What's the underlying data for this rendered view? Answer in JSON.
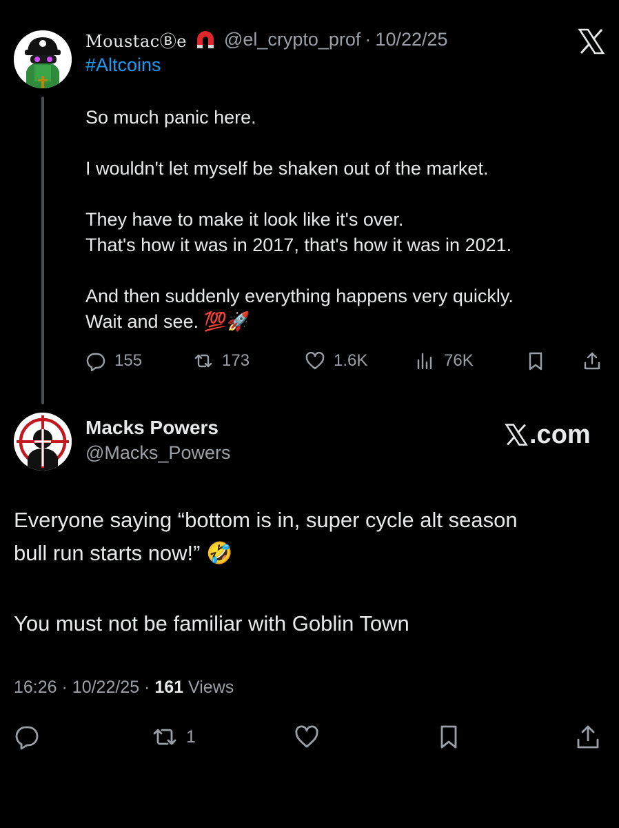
{
  "quoted_post": {
    "author_name": "MoustacⒷe",
    "handle": "@el_crypto_prof",
    "separator": "·",
    "date": "10/22/25",
    "hashtag": "#Altcoins",
    "paragraphs": [
      [
        "So much panic here."
      ],
      [
        "I wouldn't let myself be shaken out of the market."
      ],
      [
        "They have to make it look like it's over.",
        "That's how it was in 2017, that's how it was in 2021."
      ],
      [
        "And then suddenly everything happens very quickly.",
        "Wait and see. 💯🚀"
      ]
    ],
    "actions": {
      "replies": "155",
      "reposts": "173",
      "likes": "1.6K",
      "views": "76K"
    }
  },
  "main_post": {
    "author_name": "Macks Powers",
    "handle": "@Macks_Powers",
    "site_label": ".com",
    "line1": "Everyone saying “bottom is in, super cycle alt season",
    "line2": "bull run starts now!” 🤣",
    "line3": "You must not be familiar with Goblin Town",
    "meta": {
      "time": "16:26",
      "date": "10/22/25",
      "separator": "·",
      "views_count": "161",
      "views_label": "Views"
    },
    "actions": {
      "reposts": "1"
    }
  },
  "colors": {
    "background": "#000000",
    "text": "#e7e9ea",
    "muted": "#9aa0a6",
    "link": "#1d9bf0",
    "magnet_red": "#e0272b"
  },
  "icons": [
    "x-logo-icon",
    "magnet-icon",
    "reply-icon",
    "repost-icon",
    "like-icon",
    "views-icon",
    "bookmark-icon",
    "share-icon"
  ]
}
